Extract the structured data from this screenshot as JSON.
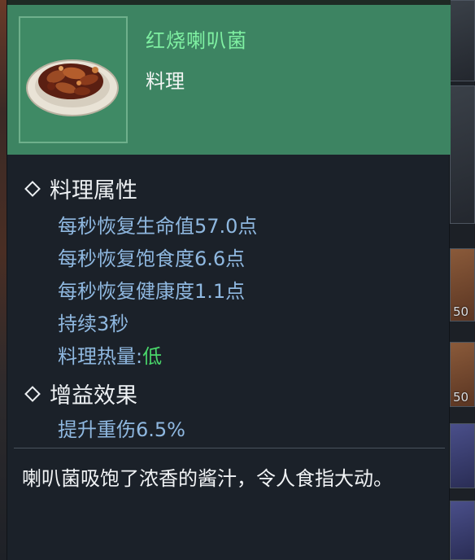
{
  "item": {
    "name": "红烧喇叭菌",
    "type": "料理",
    "icon": "braised-mushroom-dish"
  },
  "sections": {
    "attributes": {
      "title": "料理属性",
      "lines": [
        "每秒恢复生命值57.0点",
        "每秒恢复饱食度6.6点",
        "每秒恢复健康度1.1点",
        "持续3秒"
      ],
      "heat_label": "料理热量:",
      "heat_value": "低"
    },
    "buff": {
      "title": "增益效果",
      "lines": [
        "提升重伤6.5%"
      ]
    }
  },
  "description": "喇叭菌吸饱了浓香的酱汁，令人食指大动。",
  "background": {
    "slot_counts": [
      "50",
      "50"
    ]
  },
  "colors": {
    "header_bg": "#3d8462",
    "name": "#7ff0a2",
    "attribute_text": "#8fb8e0",
    "heat_low": "#49d66a",
    "panel_bg": "#1b2129"
  }
}
